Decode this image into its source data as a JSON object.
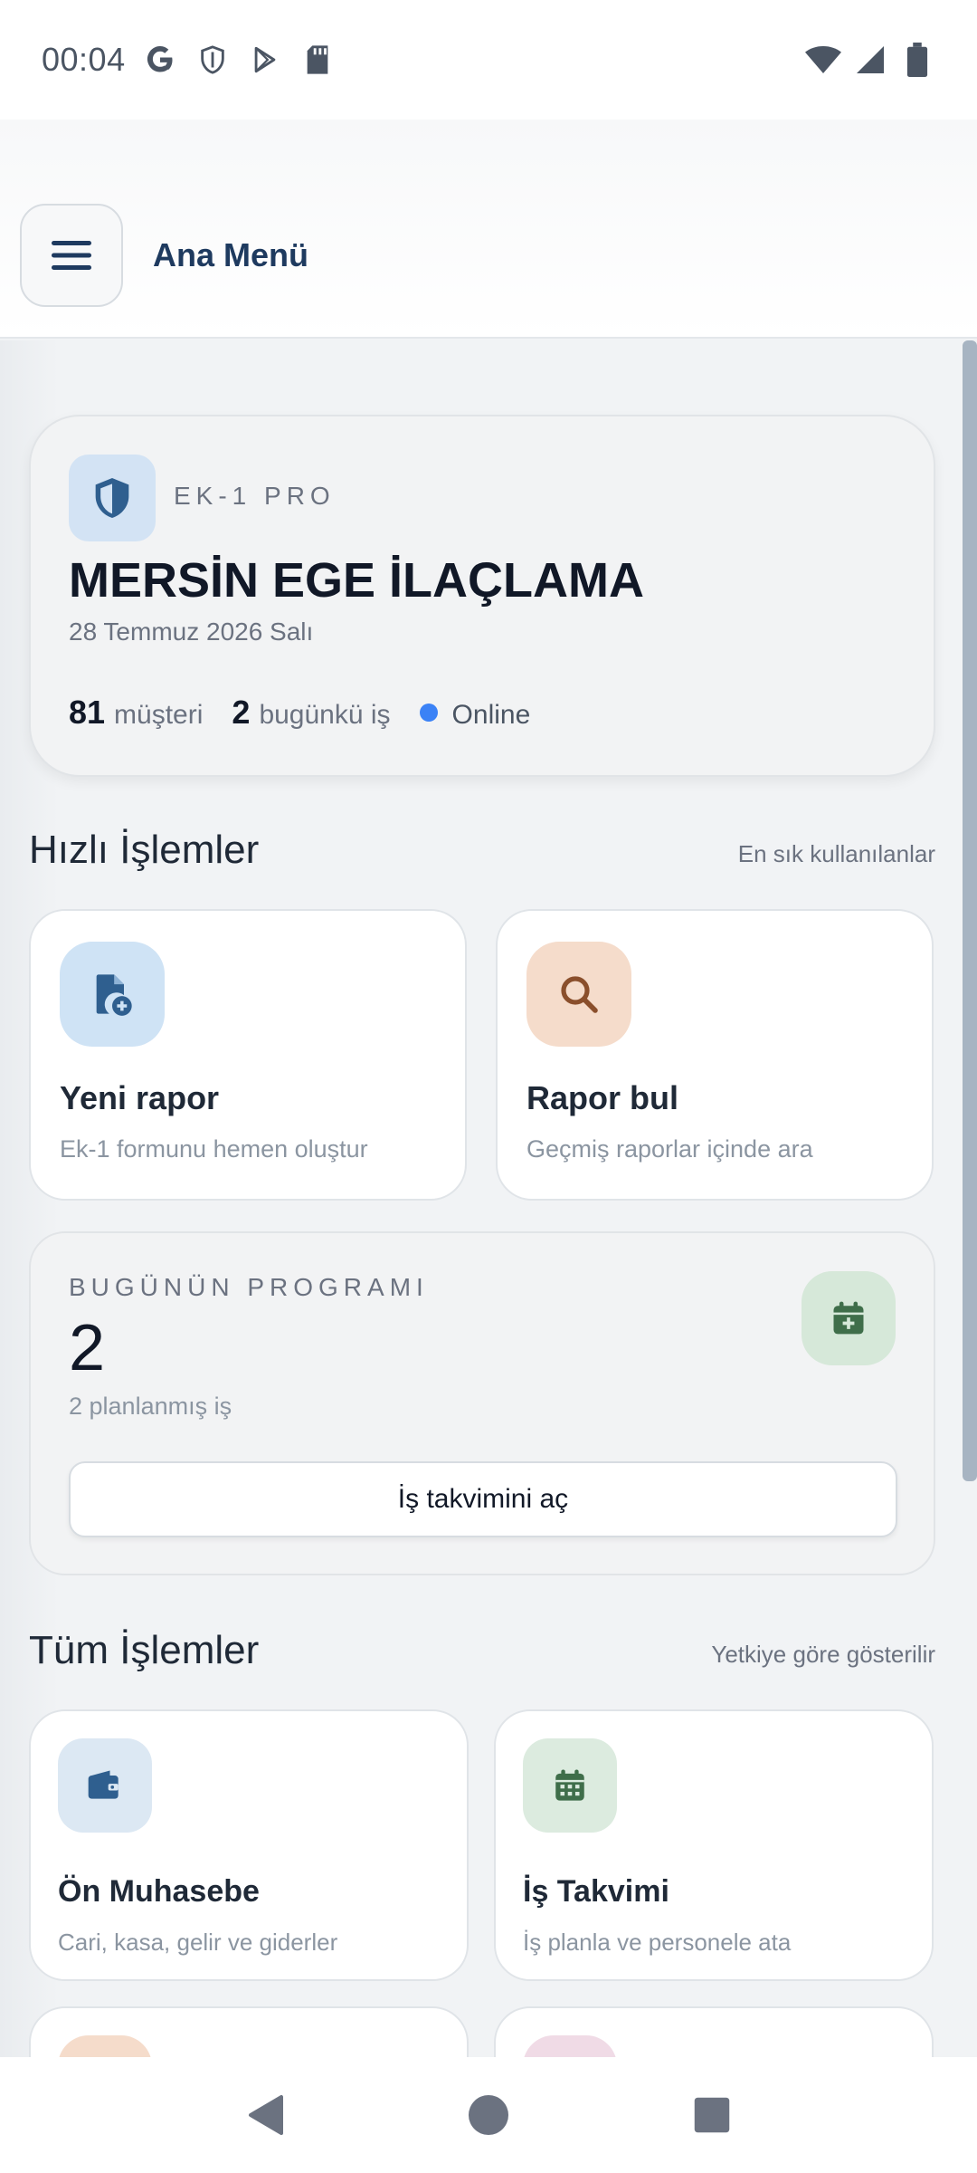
{
  "status_bar": {
    "time": "00:04",
    "icons": [
      "google-icon",
      "shield-icon",
      "play-store-icon",
      "sd-card-icon",
      "wifi-icon",
      "signal-icon",
      "battery-icon"
    ]
  },
  "header": {
    "title": "Ana Menü",
    "menu_icon": "hamburger-menu-icon"
  },
  "hero": {
    "brand": "EK-1 PRO",
    "company": "MERSİN EGE İLAÇLAMA",
    "date": "28 Temmuz 2026 Salı",
    "customers_count": "81",
    "customers_label": "müşteri",
    "today_jobs_count": "2",
    "today_jobs_label": "bugünkü iş",
    "status": "Online",
    "status_color": "#3b82f6"
  },
  "quick_actions": {
    "title": "Hızlı İşlemler",
    "hint": "En sık kullanılanlar",
    "items": [
      {
        "icon": "new-document-icon",
        "title": "Yeni rapor",
        "subtitle": "Ek-1 formunu hemen oluştur",
        "bg": "#cfe3f5"
      },
      {
        "icon": "search-icon",
        "title": "Rapor bul",
        "subtitle": "Geçmiş raporlar içinde ara",
        "bg": "#f5dccb"
      }
    ]
  },
  "today_program": {
    "label": "BUGÜNÜN PROGRAMI",
    "count": "2",
    "subtitle": "2 planlanmış iş",
    "button": "İş takvimini aç",
    "icon": "calendar-add-icon"
  },
  "all_actions": {
    "title": "Tüm İşlemler",
    "hint": "Yetkiye göre gösterilir",
    "items": [
      {
        "icon": "wallet-icon",
        "title": "Ön Muhasebe",
        "subtitle": "Cari, kasa, gelir ve giderler",
        "bg": "#dce8f3"
      },
      {
        "icon": "calendar-icon",
        "title": "İş Takvimi",
        "subtitle": "İş planla ve personele ata",
        "bg": "#dcebdf"
      }
    ]
  },
  "colors": {
    "accent_blue": "#2f5f8f",
    "accent_green": "#3f6e4a",
    "accent_brown": "#8a4f2c"
  }
}
